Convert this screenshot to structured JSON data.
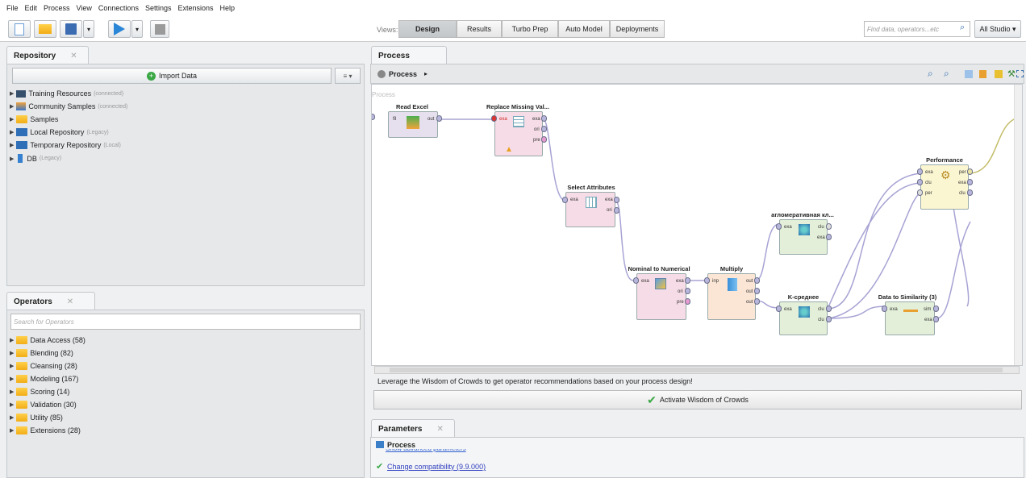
{
  "menu": [
    "File",
    "Edit",
    "Process",
    "View",
    "Connections",
    "Settings",
    "Extensions",
    "Help"
  ],
  "toolbar": {
    "views_label": "Views:",
    "view_tabs": [
      "Design",
      "Results",
      "Turbo Prep",
      "Auto Model",
      "Deployments"
    ],
    "search_placeholder": "Find data, operators...etc",
    "studio_dropdown": "All Studio ▾"
  },
  "repository": {
    "tab": "Repository",
    "import_button": "Import Data",
    "items": [
      {
        "label": "Training Resources",
        "sub": "(connected)"
      },
      {
        "label": "Community Samples",
        "sub": "(connected)"
      },
      {
        "label": "Samples",
        "sub": ""
      },
      {
        "label": "Local Repository",
        "sub": "(Legacy)"
      },
      {
        "label": "Temporary Repository",
        "sub": "(Local)"
      },
      {
        "label": "DB",
        "sub": "(Legacy)"
      }
    ]
  },
  "operators": {
    "tab": "Operators",
    "search_placeholder": "Search for Operators",
    "items": [
      "Data Access (58)",
      "Blending (82)",
      "Cleansing (28)",
      "Modeling (167)",
      "Scoring (14)",
      "Validation (30)",
      "Utility (85)",
      "Extensions (28)"
    ]
  },
  "process": {
    "tab": "Process",
    "breadcrumb": "Process",
    "canvas_label": "Process",
    "operators": [
      {
        "name": "Read Excel"
      },
      {
        "name": "Replace Missing Val..."
      },
      {
        "name": "Select Attributes"
      },
      {
        "name": "Nominal to Numerical"
      },
      {
        "name": "Multiply"
      },
      {
        "name": "агломеративная кл..."
      },
      {
        "name": "K-среднее"
      },
      {
        "name": "Data to Similarity (3)"
      },
      {
        "name": "Performance"
      }
    ],
    "hint": "Leverage the Wisdom of Crowds to get operator recommendations based on your process design!",
    "wisdom_button": "Activate Wisdom of Crowds"
  },
  "parameters": {
    "tab": "Parameters",
    "process_label": "Process",
    "link_hidden": "Show advanced parameters",
    "compat": "Change compatibility (9.9.000)"
  },
  "colors": {
    "accent": "#2f7fd0",
    "pink": "#f6dce6",
    "green": "#e3efd8",
    "yellow": "#fbf6d2",
    "orange": "#fbe6d6"
  }
}
